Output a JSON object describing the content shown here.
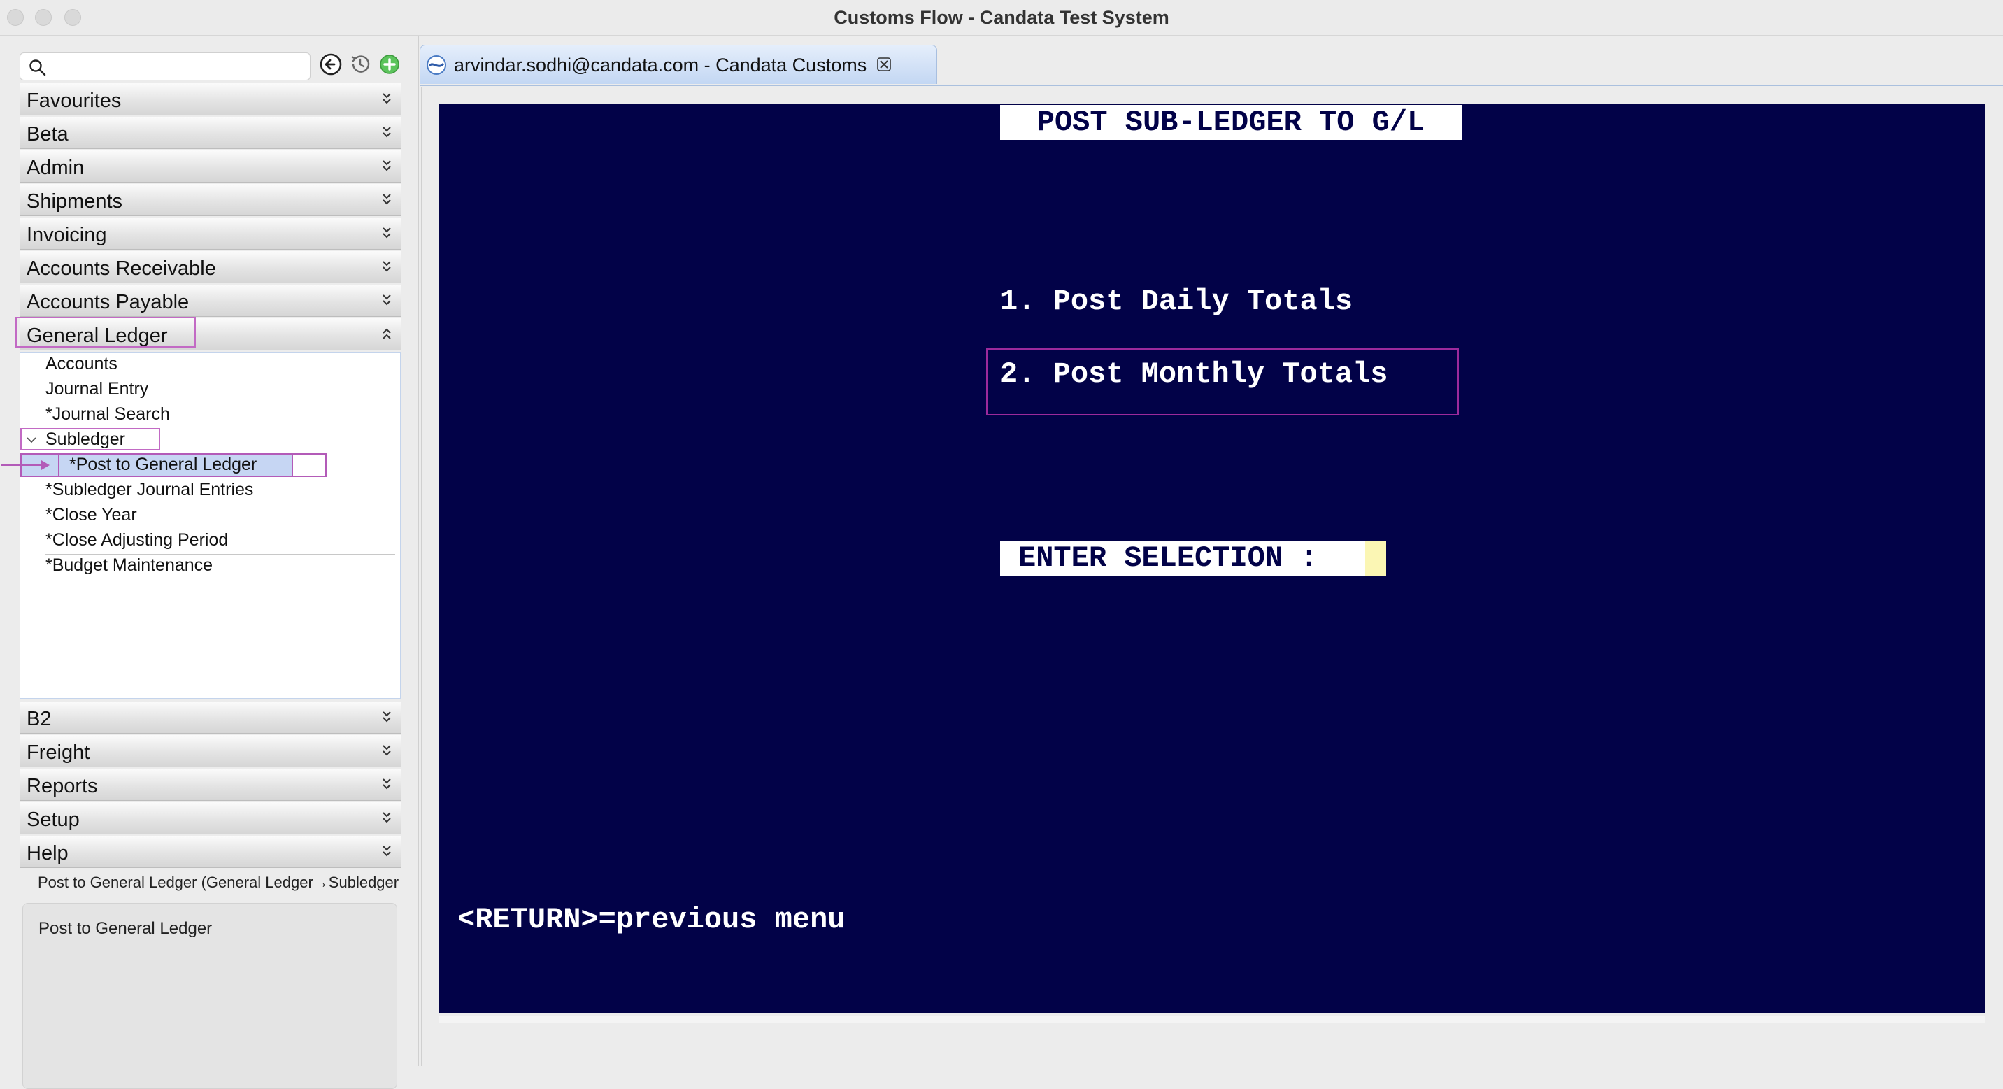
{
  "window": {
    "title": "Customs Flow - Candata Test System"
  },
  "sidebar": {
    "search": {
      "value": "",
      "placeholder": ""
    },
    "tools": [
      "back-icon",
      "history-icon",
      "add-icon"
    ],
    "sections_top": [
      {
        "label": "Favourites",
        "expanded": false
      },
      {
        "label": "Beta",
        "expanded": false
      },
      {
        "label": "Admin",
        "expanded": false
      },
      {
        "label": "Shipments",
        "expanded": false
      },
      {
        "label": "Invoicing",
        "expanded": false
      },
      {
        "label": "Accounts Receivable",
        "expanded": false
      },
      {
        "label": "Accounts Payable",
        "expanded": false
      }
    ],
    "general_ledger": {
      "label": "General Ledger",
      "expanded": true,
      "items": [
        {
          "label": "Accounts"
        },
        {
          "label": "Journal Entry"
        },
        {
          "label": "*Journal Search"
        },
        {
          "label": "Subledger",
          "expanded": true
        },
        {
          "label": "*Post to General Ledger",
          "selected": true
        },
        {
          "label": "*Subledger Journal Entries"
        },
        {
          "label": "*Close Year"
        },
        {
          "label": "*Close Adjusting Period"
        },
        {
          "label": "*Budget Maintenance"
        }
      ]
    },
    "sections_bottom": [
      {
        "label": "B2",
        "expanded": false
      },
      {
        "label": "Freight",
        "expanded": false
      },
      {
        "label": "Reports",
        "expanded": false
      },
      {
        "label": "Setup",
        "expanded": false
      },
      {
        "label": "Help",
        "expanded": false
      }
    ],
    "status_path": "Post to General Ledger (General Ledger→Subledger",
    "description": "Post to General Ledger"
  },
  "tab": {
    "label": "arvindar.sodhi@candata.com - Candata Customs",
    "close_icon": "close-icon"
  },
  "terminal": {
    "title": "POST SUB-LEDGER TO G/L",
    "options": [
      {
        "label": "1. Post Daily Totals"
      },
      {
        "label": "2. Post Monthly Totals",
        "highlighted": true
      }
    ],
    "prompt": "ENTER SELECTION :",
    "input_value": "",
    "footer": "<RETURN>=previous menu"
  },
  "colors": {
    "terminal_bg": "#020248",
    "terminal_fg": "#ffffff",
    "input_bg": "#fbf6b4",
    "annotation_outline": "#b35bb8",
    "selection_bg": "#c6d6f3"
  }
}
